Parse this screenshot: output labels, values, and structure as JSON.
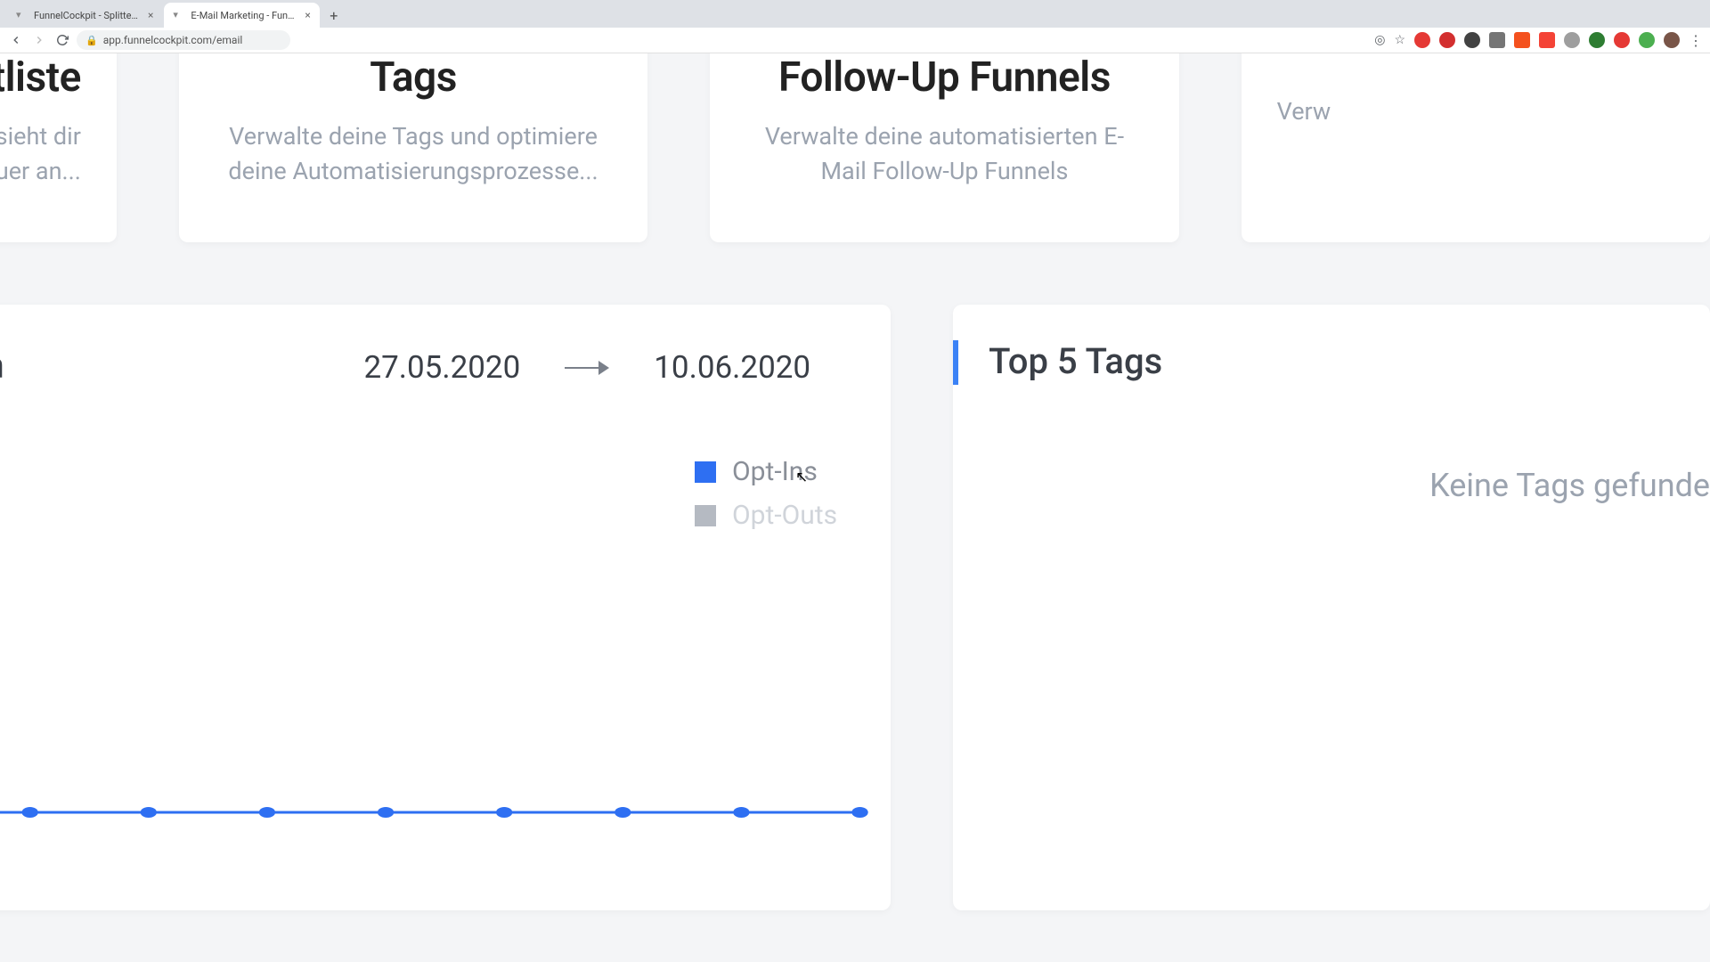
{
  "browser": {
    "tabs": [
      {
        "label": "FunnelCockpit - Splittests, M…"
      },
      {
        "label": "E-Mail Marketing - FunnelCoc…"
      }
    ],
    "url": "app.funnelcockpit.com/email"
  },
  "cards": {
    "left": {
      "title": "tliste",
      "desc_line1": "ktliste und sieht dir",
      "desc_line2": "enauer an..."
    },
    "tags": {
      "title": "Tags",
      "desc": "Verwalte deine Tags und optimiere deine Automatisierungsprozesse..."
    },
    "followup": {
      "title": "Follow-Up Funnels",
      "desc": "Verwalte deine automatisierten E-Mail Follow-Up Funnels"
    },
    "right_edge": {
      "desc": "Verw"
    }
  },
  "left_panel": {
    "title_fragment": "n",
    "date_from": "27.05.2020",
    "date_to": "10.06.2020",
    "legend": {
      "opt_ins": "Opt-Ins",
      "opt_outs": "Opt-Outs"
    }
  },
  "right_panel": {
    "title": "Top 5 Tags",
    "empty": "Keine Tags gefunde"
  },
  "chart_data": {
    "type": "line",
    "x_start": "27.05.2020",
    "x_end": "10.06.2020",
    "series": [
      {
        "name": "Opt-Ins",
        "color": "#2e6ff2",
        "active": true,
        "values": [
          0,
          0,
          0,
          0,
          0,
          0,
          0,
          0,
          0,
          0,
          0,
          0
        ]
      },
      {
        "name": "Opt-Outs",
        "color": "#b5bac2",
        "active": false,
        "values": []
      }
    ]
  },
  "colors": {
    "accent_blue": "#3b82f6",
    "series_blue": "#2e6ff2",
    "grey": "#9ba3af"
  }
}
